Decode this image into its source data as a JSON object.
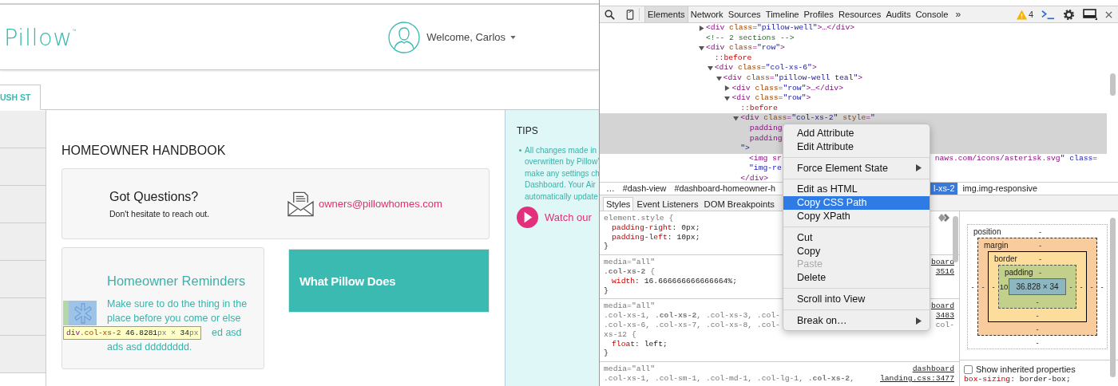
{
  "page": {
    "logo": "Pillow",
    "trademark": "™",
    "user_menu": {
      "label": "Welcome, Carlos"
    },
    "tab": {
      "label": "USH ST",
      "selected": true
    },
    "heading": "HOMEOWNER HANDBOOK",
    "contact_card": {
      "title": "Got Questions?",
      "subtitle": "Don't hesitate to reach out.",
      "email": "owners@pillowhomes.com"
    },
    "reminders_card": {
      "title": "Homeowner Reminders",
      "lines": [
        "Make sure to do the thing in the",
        "place before you come or else",
        "ed asd",
        "ads asd dddddddd."
      ]
    },
    "feature_card": {
      "title": "What Pillow Does"
    },
    "tips": {
      "title": "TIPS",
      "bullet_lines": [
        "All changes made in",
        "overwritten by Pillow’",
        "make any settings ch",
        "Dashboard. Your Air",
        "automatically update"
      ],
      "video_link": "Watch our"
    },
    "inspect_tooltip": [
      {
        "text": "div",
        "kind": "tag"
      },
      {
        "text": ".col-xs-2",
        "kind": "class"
      },
      {
        "text": " 46.8281",
        "kind": "number"
      },
      {
        "text": "px",
        "kind": "unit"
      },
      {
        "text": " × ",
        "kind": "unit"
      },
      {
        "text": "34",
        "kind": "number"
      },
      {
        "text": "px",
        "kind": "unit"
      }
    ]
  },
  "devtools": {
    "toolbar": {
      "tabs": [
        {
          "label": "Elements",
          "selected": true
        },
        {
          "label": "Network",
          "selected": false
        },
        {
          "label": "Sources",
          "selected": false
        },
        {
          "label": "Timeline",
          "selected": false
        },
        {
          "label": "Profiles",
          "selected": false
        },
        {
          "label": "Resources",
          "selected": false
        },
        {
          "label": "Audits",
          "selected": false
        },
        {
          "label": "Console",
          "selected": false
        }
      ],
      "overflow": "»",
      "warning_count": "4"
    },
    "dom_tree": [
      {
        "kind": "element",
        "expanded": false,
        "selected": false,
        "lines": [
          [
            "<div class=\"pillow-well\">…</div>"
          ]
        ]
      },
      {
        "kind": "comment",
        "selected": false,
        "lines": [
          [
            "<!-- 2 sections -->"
          ]
        ]
      },
      {
        "kind": "element",
        "expanded": true,
        "selected": false,
        "lines": [
          [
            "<div class=\"row\">"
          ]
        ],
        "children": [
          {
            "kind": "pseudo",
            "selected": false,
            "lines": [
              [
                "::before"
              ]
            ]
          },
          {
            "kind": "element",
            "expanded": true,
            "selected": false,
            "lines": [
              [
                "<div class=\"col-xs-6\">"
              ]
            ],
            "children": [
              {
                "kind": "element",
                "expanded": true,
                "selected": false,
                "lines": [
                  [
                    "<div class=\"pillow-well teal\">"
                  ]
                ],
                "children": [
                  {
                    "kind": "element",
                    "expanded": false,
                    "selected": false,
                    "lines": [
                      [
                        "<div class=\"row\">…</div>"
                      ]
                    ]
                  },
                  {
                    "kind": "element",
                    "expanded": true,
                    "selected": false,
                    "lines": [
                      [
                        "<div class=\"row\">"
                      ]
                    ],
                    "children": [
                      {
                        "kind": "pseudo",
                        "selected": false,
                        "lines": [
                          [
                            "::before"
                          ]
                        ]
                      },
                      {
                        "kind": "element",
                        "expanded": true,
                        "selected": true,
                        "lines": [
                          [
                            "<div class=\"col-xs-2\" style=\""
                          ],
                          [
                            "  padding"
                          ],
                          [
                            "  padding"
                          ],
                          [
                            "\">"
                          ]
                        ],
                        "closing": "</div>",
                        "children": [
                          {
                            "kind": "element",
                            "selected": false,
                            "lines": [
                              [
                                "<img sr",
                                "naws.com/icons/asterisk.svg\" class="
                              ],
                              [
                                "\"img-re"
                              ]
                            ]
                          }
                        ]
                      }
                    ]
                  }
                ]
              }
            ]
          }
        ]
      }
    ],
    "breadcrumbs": {
      "before_menu": [
        {
          "label": "…",
          "selected": false
        },
        {
          "label": "#dash-view",
          "selected": false
        },
        {
          "label": "#dashboard-homeowner-h",
          "selected": false
        }
      ],
      "after_menu": [
        {
          "label": "l-xs-2",
          "selected": true
        },
        {
          "label": "img.img-responsive",
          "selected": false
        }
      ]
    },
    "pane_tabs": [
      {
        "label": "Styles",
        "selected": true
      },
      {
        "label": "Event Listeners",
        "selected": false
      },
      {
        "label": "DOM Breakpoints",
        "selected": false
      }
    ],
    "style_rules": [
      {
        "add_rule_button": true,
        "rows": [
          {
            "kind": "selector",
            "text": "element.style {"
          },
          {
            "kind": "property",
            "text": "padding-right: 0px;"
          },
          {
            "kind": "property",
            "text": "padding-left: 10px;"
          },
          {
            "kind": "brace",
            "text": "}"
          }
        ]
      },
      {
        "rows": [
          {
            "kind": "media",
            "text": "media=\"all\"",
            "right": {
              "kind": "link",
              "text": "board"
            }
          },
          {
            "kind": "selector",
            "text": "**.col-xs-2** {",
            "right": {
              "kind": "link",
              "text": "3516"
            }
          },
          {
            "kind": "property",
            "text": "width: 16.666666666666664%;"
          },
          {
            "kind": "brace",
            "text": "}"
          }
        ]
      },
      {
        "rows": [
          {
            "kind": "media",
            "text": "media=\"all\"",
            "right": {
              "kind": "link",
              "text": "board"
            }
          },
          {
            "kind": "selector",
            "text": ".col-xs-1, **.col-xs-2**, .col-xs-3, .col-",
            "right": {
              "kind": "link",
              "text": "3483"
            }
          },
          {
            "kind": "selector",
            "text": ".col-xs-6, .col-xs-7, .col-xs-8, .col-",
            "right": {
              "kind": "text",
              "text": "col-"
            }
          },
          {
            "kind": "selector",
            "text": "xs-12 {"
          },
          {
            "kind": "property",
            "text": "float: left;"
          },
          {
            "kind": "brace",
            "text": "}"
          }
        ]
      },
      {
        "rows": [
          {
            "kind": "media",
            "text": "media=\"all\"",
            "right": {
              "kind": "link",
              "text": "dashboard"
            }
          },
          {
            "kind": "selector",
            "text": ".col-xs-1, .col-sm-1, .col-md-1, .col-lg-1, **.col-xs-2**,",
            "right": {
              "kind": "link",
              "text": "landing.css:3477"
            }
          }
        ]
      }
    ],
    "box_model": {
      "layers": [
        {
          "label": "position"
        },
        {
          "label": "margin"
        },
        {
          "label": "border"
        },
        {
          "label": "padding"
        }
      ],
      "top_values": [
        "-",
        "-",
        "-",
        "-"
      ],
      "left_values": [
        "-",
        "-",
        "-",
        "10"
      ],
      "content": "36.828 × 34",
      "right_values": [
        "-",
        "-",
        "-",
        "-"
      ],
      "bottom_values": [
        "-",
        "-",
        "-",
        "-"
      ]
    },
    "computed": {
      "show_inherited": {
        "label": "Show inherited properties",
        "checked": false
      },
      "properties": [
        {
          "text": "box-sizing: border-box;"
        }
      ]
    },
    "context_menu": [
      {
        "kind": "item",
        "label": "Add Attribute",
        "selected": false,
        "disabled": false,
        "submenu": false
      },
      {
        "kind": "item",
        "label": "Edit Attribute",
        "selected": false,
        "disabled": false,
        "submenu": false
      },
      {
        "kind": "separator"
      },
      {
        "kind": "item",
        "label": "Force Element State",
        "selected": false,
        "disabled": false,
        "submenu": true
      },
      {
        "kind": "separator"
      },
      {
        "kind": "item",
        "label": "Edit as HTML",
        "selected": false,
        "disabled": false,
        "submenu": false
      },
      {
        "kind": "item",
        "label": "Copy CSS Path",
        "selected": true,
        "disabled": false,
        "submenu": false
      },
      {
        "kind": "item",
        "label": "Copy XPath",
        "selected": false,
        "disabled": false,
        "submenu": false
      },
      {
        "kind": "separator"
      },
      {
        "kind": "item",
        "label": "Cut",
        "selected": false,
        "disabled": false,
        "submenu": false
      },
      {
        "kind": "item",
        "label": "Copy",
        "selected": false,
        "disabled": false,
        "submenu": false
      },
      {
        "kind": "item",
        "label": "Paste",
        "selected": false,
        "disabled": true,
        "submenu": false
      },
      {
        "kind": "item",
        "label": "Delete",
        "selected": false,
        "disabled": false,
        "submenu": false
      },
      {
        "kind": "separator"
      },
      {
        "kind": "item",
        "label": "Scroll into View",
        "selected": false,
        "disabled": false,
        "submenu": false
      },
      {
        "kind": "separator"
      },
      {
        "kind": "item",
        "label": "Break on…",
        "selected": false,
        "disabled": false,
        "submenu": true
      }
    ]
  }
}
